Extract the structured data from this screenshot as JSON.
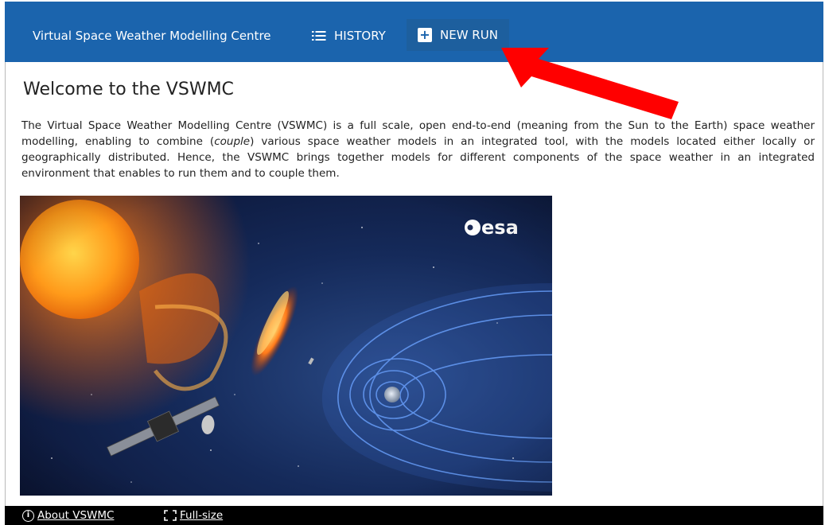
{
  "navbar": {
    "brand": "Virtual Space Weather Modelling Centre",
    "history_label": "HISTORY",
    "new_run_label": "NEW RUN",
    "color": "#1b64ad"
  },
  "main": {
    "heading": "Welcome to the VSWMC",
    "intro_before": "The Virtual Space Weather Modelling Centre (VSWMC) is a full scale, open end-to-end (meaning from the Sun to the Earth) space weather modelling, enabling to combine (",
    "intro_italic": "couple",
    "intro_after": ") various space weather models in an integrated tool, with the models located either locally or geographically distributed. Hence, the VSWMC brings together models for different components of the space weather in an integrated environment that enables to run them and to couple them.",
    "hero_logo": "esa"
  },
  "footer": {
    "about_label": "About VSWMC",
    "fullsize_label": "Full-size",
    "icons": [
      "info-icon",
      "fullscreen-icon"
    ]
  },
  "annotation": {
    "arrow_color": "#ff0000"
  }
}
